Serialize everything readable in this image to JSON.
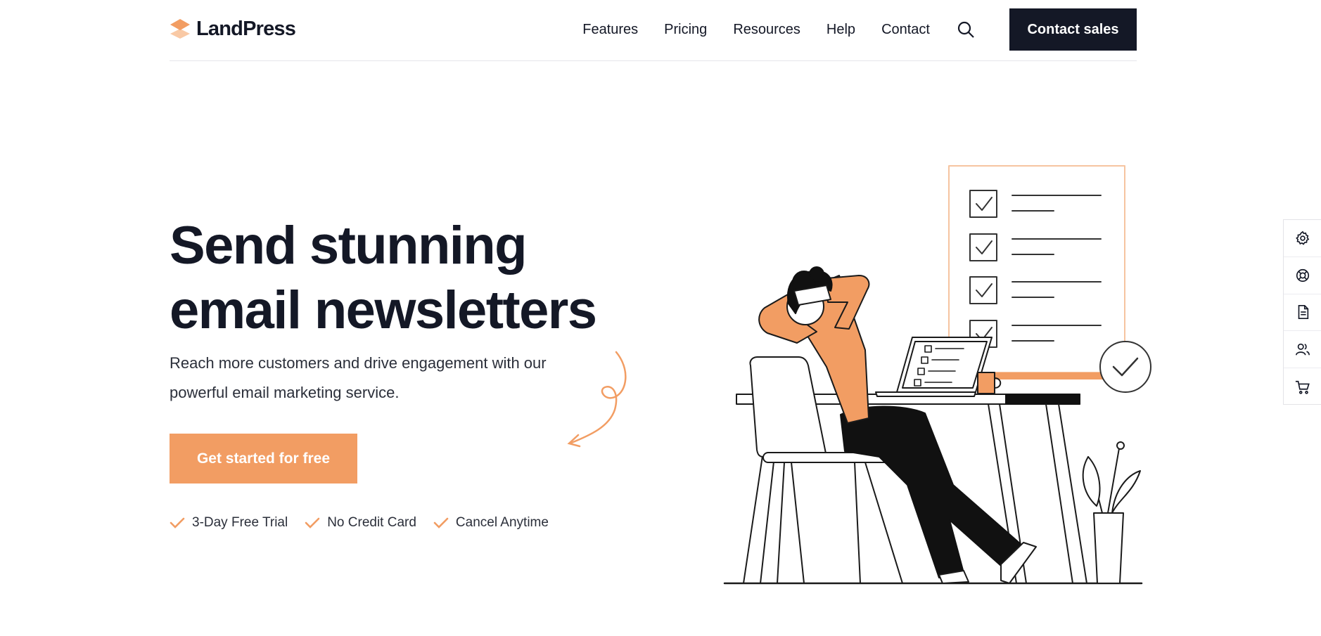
{
  "brand": {
    "name": "LandPress",
    "accent": "#f29d63",
    "dark": "#141826"
  },
  "nav": {
    "items": [
      "Features",
      "Pricing",
      "Resources",
      "Help",
      "Contact"
    ],
    "search_icon": "search-icon",
    "cta_label": "Contact sales"
  },
  "hero": {
    "title_line1": "Send stunning",
    "title_line2_plain": "email ",
    "title_line2_highlight": "newsletters",
    "subtitle": "Reach more customers and drive engagement with our powerful email marketing service.",
    "cta_label": "Get started for free",
    "features": [
      "3-Day Free Trial",
      "No Credit Card",
      "Cancel Anytime"
    ]
  },
  "side_toolbar": {
    "icons": [
      "gear-icon",
      "lifebuoy-icon",
      "document-icon",
      "users-icon",
      "cart-icon"
    ]
  }
}
